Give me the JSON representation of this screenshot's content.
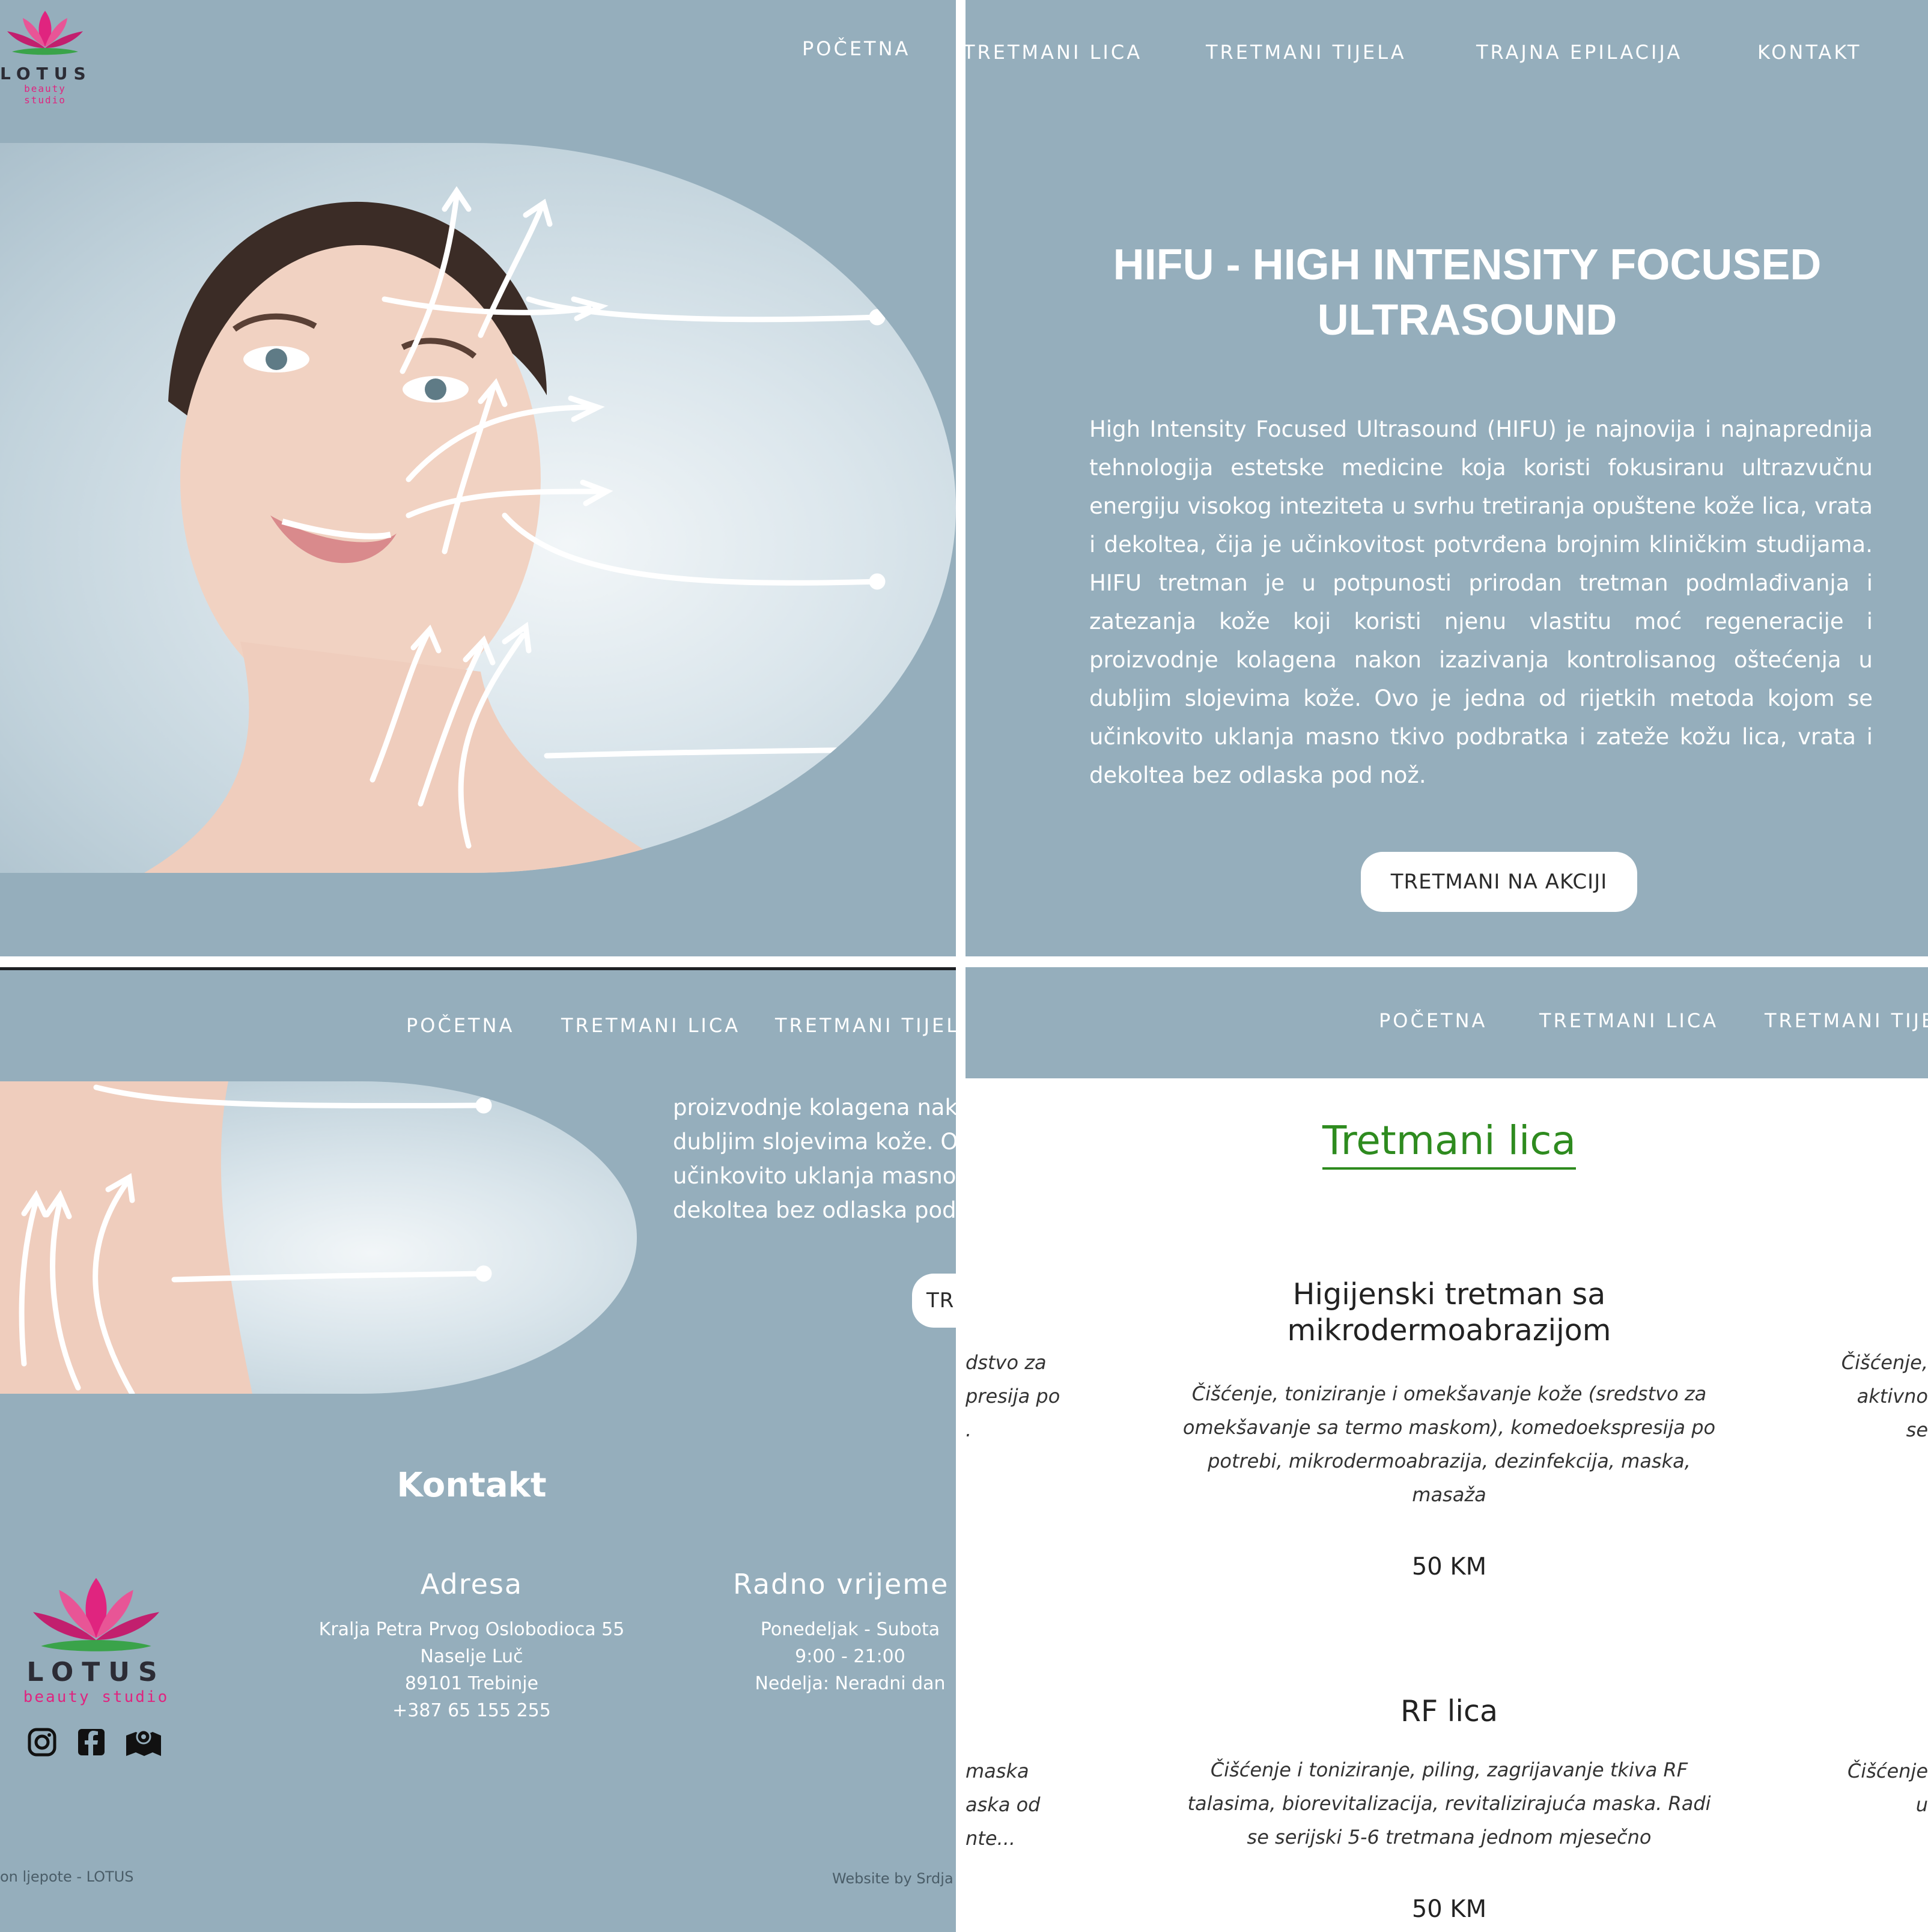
{
  "nav": {
    "home": "POČETNA",
    "face": "TRETMANI LICA",
    "body": "TRETMANI TIJELA",
    "epil": "TRAJNA EPILACIJA",
    "contact": "KONTAKT",
    "face_cut": "TRETMANI LICA",
    "body_cut": "TRETMANI TIJELA",
    "body_cut2": "TRETMANI TIJE"
  },
  "logo": {
    "word": "LOTUS",
    "sub": "beauty studio"
  },
  "hero": {
    "title_line1": "HIFU - HIGH INTENSITY FOCUSED",
    "title_line2": "ULTRASOUND",
    "paragraph": "High Intensity Focused Ultrasound (HIFU) je najnovija i najnaprednija tehnologija estetske medicine koja koristi fokusiranu ultrazvučnu energiju visokog inteziteta u svrhu tretiranja opuštene kože lica, vrata i dekoltea, čija je učinkovitost potvrđena brojnim kliničkim studijama. HIFU tretman je u potpunosti prirodan tretman podmlađivanja i zatezanja kože koji koristi njenu vlastitu moć regeneracije i proizvodnje kolagena nakon izazivanja kontrolisanog oštećenja u dubljim slojevima kože. Ovo je jedna od rijetkih metoda kojom se učinkovito uklanja masno tkivo podbratka i zateže kožu lica, vrata i dekoltea bez odlaska pod nož.",
    "button": "TRETMANI NA AKCIJI",
    "button_cut": "TRI",
    "para_fragments": [
      "proizvodnje kolagena nako",
      "dubljim slojevima kože. Ovo",
      "učinkovito uklanja masno tk",
      "dekoltea bez odlaska pod nož"
    ]
  },
  "contact": {
    "title": "Kontakt",
    "address_title": "Adresa",
    "address_lines": [
      "Kralja Petra Prvog Oslobodioca 55",
      "Naselje Luč",
      "89101 Trebinje",
      "+387 65 155 255"
    ],
    "hours_title": "Radno vrijeme",
    "hours_lines": [
      "Ponedeljak - Subota",
      "9:00 - 21:00",
      "Nedelja: Neradni dan"
    ],
    "footer_left": "on ljepote - LOTUS",
    "footer_right": "Website by Srdja"
  },
  "treatments": {
    "section_title": "Tretmani lica",
    "items": [
      {
        "title_line1": "Higijenski tretman sa",
        "title_line2": "mikrodermoabrazijom",
        "desc_lines": [
          "Čišćenje, toniziranje i omekšavanje kože (sredstvo za",
          "omekšavanje sa termo maskom), komedoekspresija po",
          "potrebi, mikrodermoabrazija, dezinfekcija, maska,",
          "masaža"
        ],
        "price": "50 KM"
      },
      {
        "title_line1": "RF lica",
        "desc_lines": [
          "Čišćenje i toniziranje, piling, zagrijavanje tkiva RF",
          "talasima, biorevitalizacija, revitalizirajuća maska. Radi",
          "se serijski 5-6 tretmana jednom mjesečno"
        ],
        "price": "50 KM"
      }
    ],
    "left_fragments_1": [
      "dstvo za",
      "presija po",
      "."
    ],
    "right_fragments_1": [
      "Čišćenje,",
      "aktivno",
      "se"
    ],
    "left_fragments_2": [
      "maska",
      "aska od",
      "nte..."
    ],
    "right_fragments_2": [
      "Čišćenje",
      "u"
    ]
  },
  "colors": {
    "panel_bg": "#95aebc",
    "accent_green": "#2e8b1f",
    "logo_pink": "#e0247f",
    "logo_green": "#3aa34a"
  },
  "icons": [
    "instagram-icon",
    "facebook-icon",
    "map-icon"
  ]
}
